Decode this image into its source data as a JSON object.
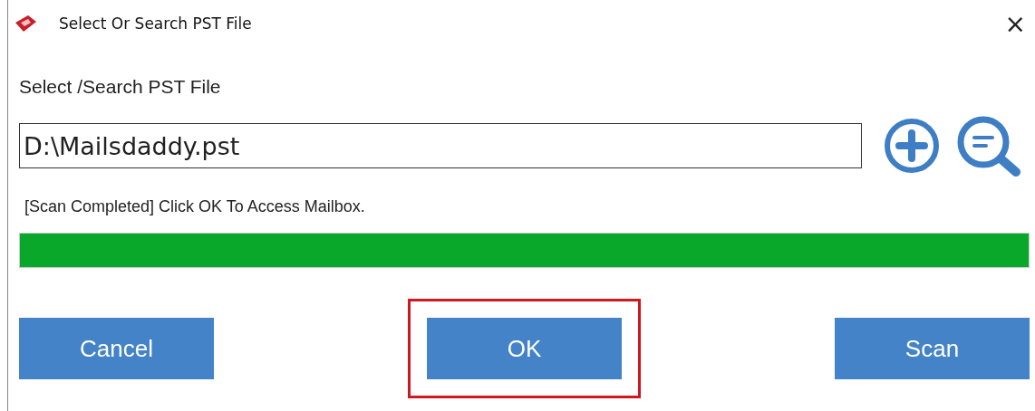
{
  "window": {
    "title": "Select Or Search PST File",
    "close": "×"
  },
  "field_label": "Select /Search PST File",
  "path_field": {
    "value": "D:\\Mailsdaddy.pst"
  },
  "status": "[Scan Completed] Click OK To Access Mailbox.",
  "progress": {
    "level": 1
  },
  "buttons": [
    {
      "label": "Cancel",
      "highlighted": false
    },
    {
      "label": "OK",
      "highlighted": true
    },
    {
      "label": "Scan",
      "highlighted": false
    }
  ]
}
